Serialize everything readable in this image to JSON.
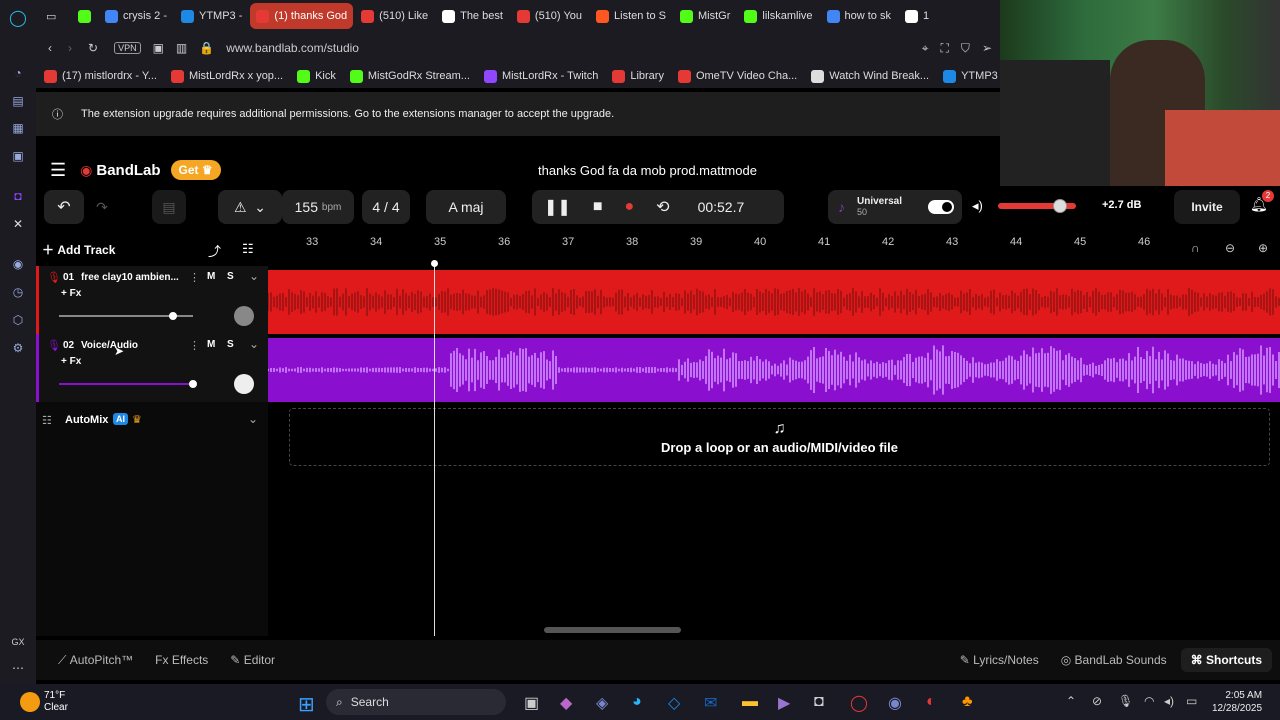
{
  "browser": {
    "tabs": [
      {
        "label": "crysis 2 -",
        "color": "#4285f4"
      },
      {
        "label": "YTMP3 -",
        "color": "#1e88e5"
      },
      {
        "label": "(1) thanks God",
        "color": "#e53935"
      },
      {
        "label": "(510) Like",
        "color": "#e53935"
      },
      {
        "label": "The best",
        "color": "#ffffff"
      },
      {
        "label": "(510) You",
        "color": "#e53935"
      },
      {
        "label": "Listen to S",
        "color": "#ff5722"
      },
      {
        "label": "MistGr",
        "color": "#53fc18"
      },
      {
        "label": "lilskamlive",
        "color": "#53fc18"
      },
      {
        "label": "how to sk",
        "color": "#4285f4"
      },
      {
        "label": "1",
        "color": "#ffffff"
      }
    ],
    "url": "www.bandlab.com/studio",
    "vpn_label": "VPN",
    "bookmarks": [
      {
        "label": "(17) mistlordrx - Y...",
        "color": "#e53935"
      },
      {
        "label": "MistLordRx x yop...",
        "color": "#e53935"
      },
      {
        "label": "Kick",
        "color": "#53fc18"
      },
      {
        "label": "MistGodRx Stream...",
        "color": "#53fc18"
      },
      {
        "label": "MistLordRx - Twitch",
        "color": "#9146ff"
      },
      {
        "label": "Library",
        "color": "#e53935"
      },
      {
        "label": "OmeTV Video Cha...",
        "color": "#e53935"
      },
      {
        "label": "Watch Wind Break...",
        "color": "#dddddd"
      },
      {
        "label": "YTMP3 - Y",
        "color": "#1e88e5"
      }
    ],
    "notice": "The extension upgrade requires additional permissions. Go to the extensions manager to accept the upgrade."
  },
  "app": {
    "brand": "BandLab",
    "get_label": "Get",
    "project_title": "thanks God fa da mob prod.mattmode",
    "tempo": "155",
    "tempo_unit": "bpm",
    "time_sig": "4 / 4",
    "key": "A maj",
    "time": "00:52.7",
    "preset_name": "Universal",
    "preset_sub": "50",
    "gain": "+2.7 dB",
    "invite": "Invite",
    "notif_count": "2",
    "master_volume": 0.8,
    "add_track": "Add Track",
    "ruler_bars": [
      "33",
      "34",
      "35",
      "36",
      "37",
      "38",
      "39",
      "40",
      "41",
      "42",
      "43",
      "44",
      "45",
      "46"
    ],
    "tracks": [
      {
        "number": "01",
        "name": "free clay10 ambien...",
        "fx": "+ Fx",
        "mute": "M",
        "solo": "S",
        "color": "#e01a1a",
        "volume": 0.85
      },
      {
        "number": "02",
        "name": "Voice/Audio",
        "fx": "+ Fx",
        "mute": "M",
        "solo": "S",
        "color": "#8a0fcf",
        "volume": 1.0
      }
    ],
    "automix": "AutoMix",
    "ai_badge": "AI",
    "drop_text": "Drop a loop or an audio/MIDI/video file",
    "bottom": {
      "autopitch": "AutoPitch™",
      "effects": "Effects",
      "editor": "Editor",
      "lyrics": "Lyrics/Notes",
      "sounds": "BandLab Sounds",
      "shortcuts": "Shortcuts"
    }
  },
  "taskbar": {
    "weather_temp": "71°F",
    "weather_desc": "Clear",
    "search": "Search",
    "time": "2:05 AM",
    "date": "12/28/2025"
  }
}
